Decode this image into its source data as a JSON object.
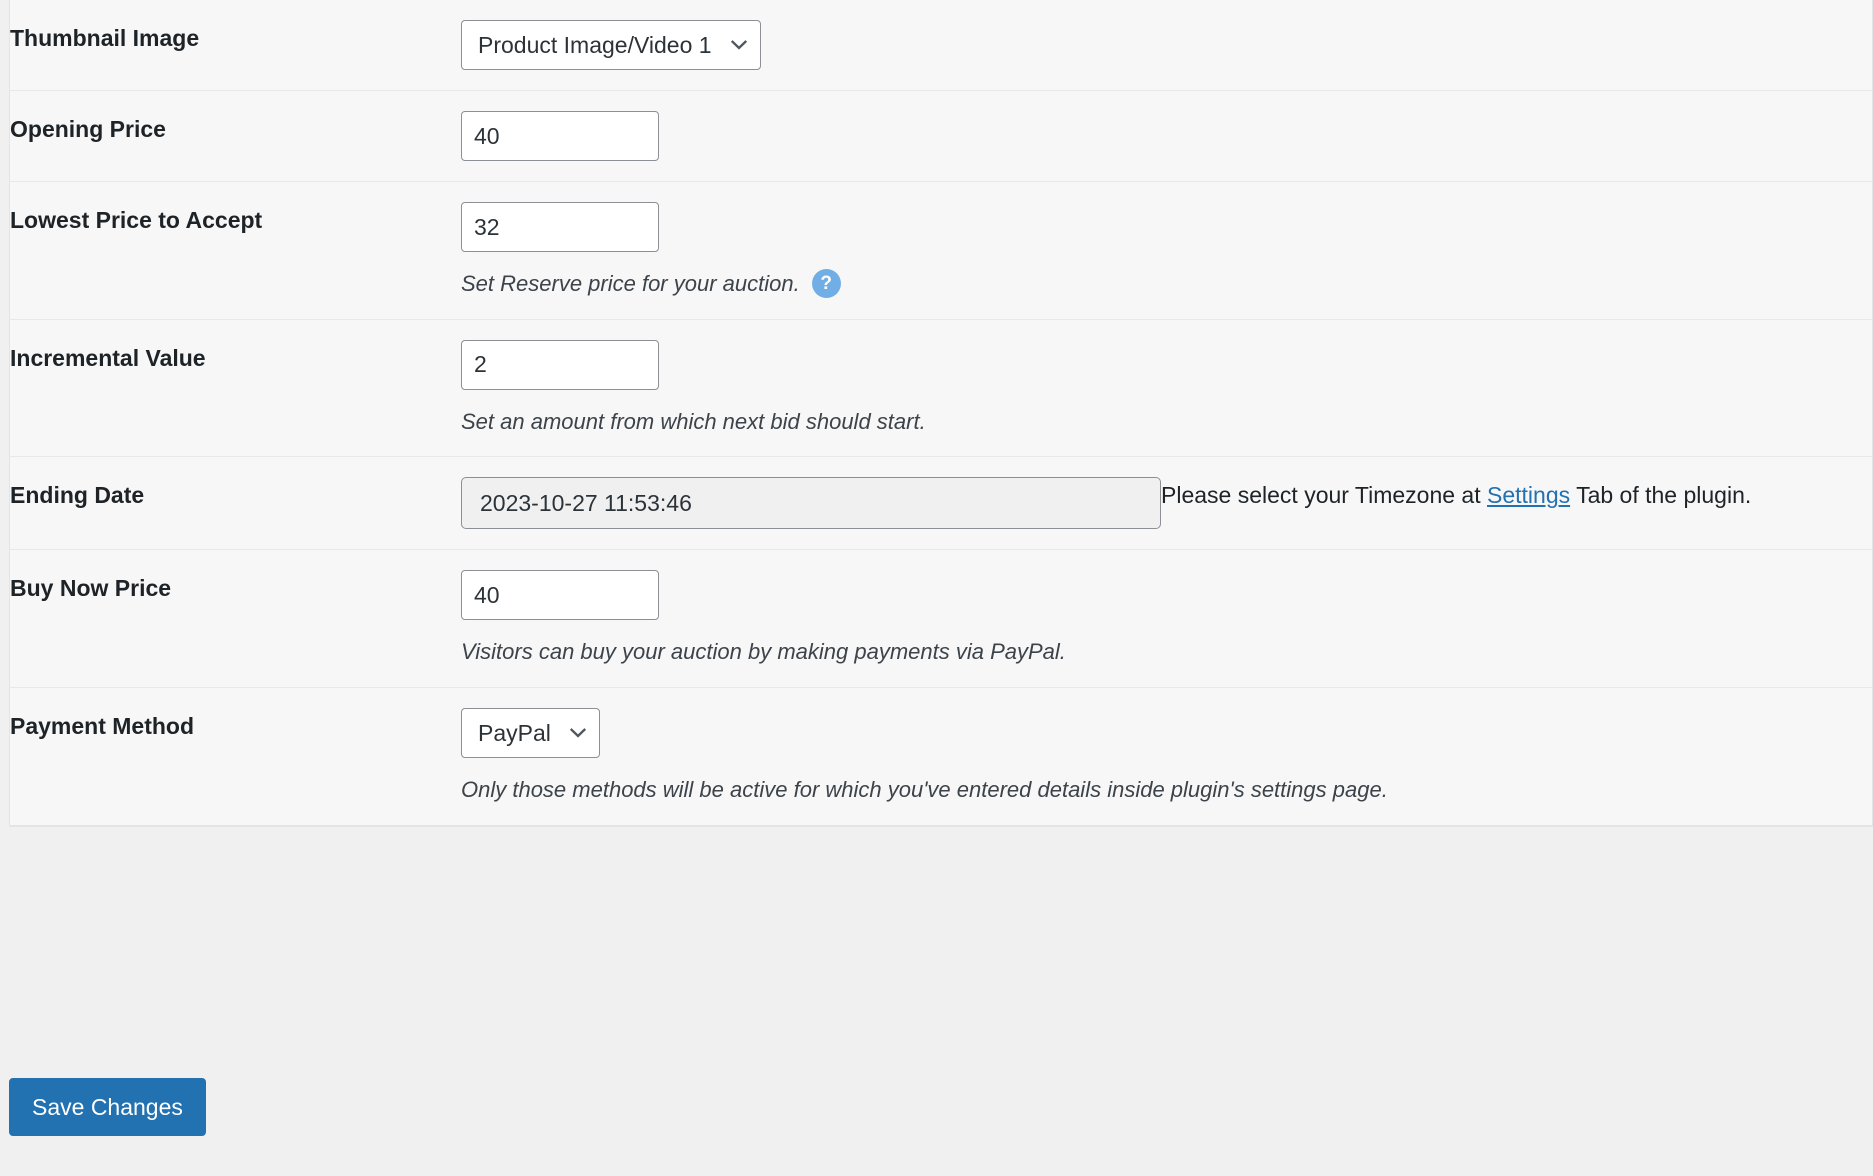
{
  "page": {
    "background_color": "#f0f0f1",
    "table_background_color": "#f7f7f7",
    "accent_color": "#2271b1",
    "help_icon_color": "#72aee6"
  },
  "form": {
    "rows": [
      {
        "label": "Thumbnail Image",
        "control": "select",
        "value": "Product Image/Video 1",
        "options": [
          "Product Image/Video 1"
        ],
        "description": ""
      },
      {
        "label": "Opening Price",
        "control": "text",
        "value": "40",
        "description": ""
      },
      {
        "label": "Lowest Price to Accept",
        "control": "text",
        "value": "32",
        "description": "Set Reserve price for your auction.",
        "help_icon": "?"
      },
      {
        "label": "Incremental Value",
        "control": "text",
        "value": "2",
        "description": "Set an amount from which next bid should start."
      },
      {
        "label": "Ending Date",
        "control": "datetime",
        "value": "2023-10-27 11:53:46",
        "note_before": "Please select your Timezone at ",
        "note_link": "Settings",
        "note_after": " Tab of the plugin."
      },
      {
        "label": "Buy Now Price",
        "control": "text",
        "value": "40",
        "description": "Visitors can buy your auction by making payments via PayPal."
      },
      {
        "label": "Payment Method",
        "control": "select",
        "value": "PayPal",
        "options": [
          "PayPal"
        ],
        "description": "Only those methods will be active for which you've entered details inside plugin's settings page."
      }
    ]
  },
  "submit": {
    "save_label": "Save Changes"
  },
  "icons": {
    "chevron_down": "chevron-down-icon",
    "help": "help-circle-icon"
  }
}
